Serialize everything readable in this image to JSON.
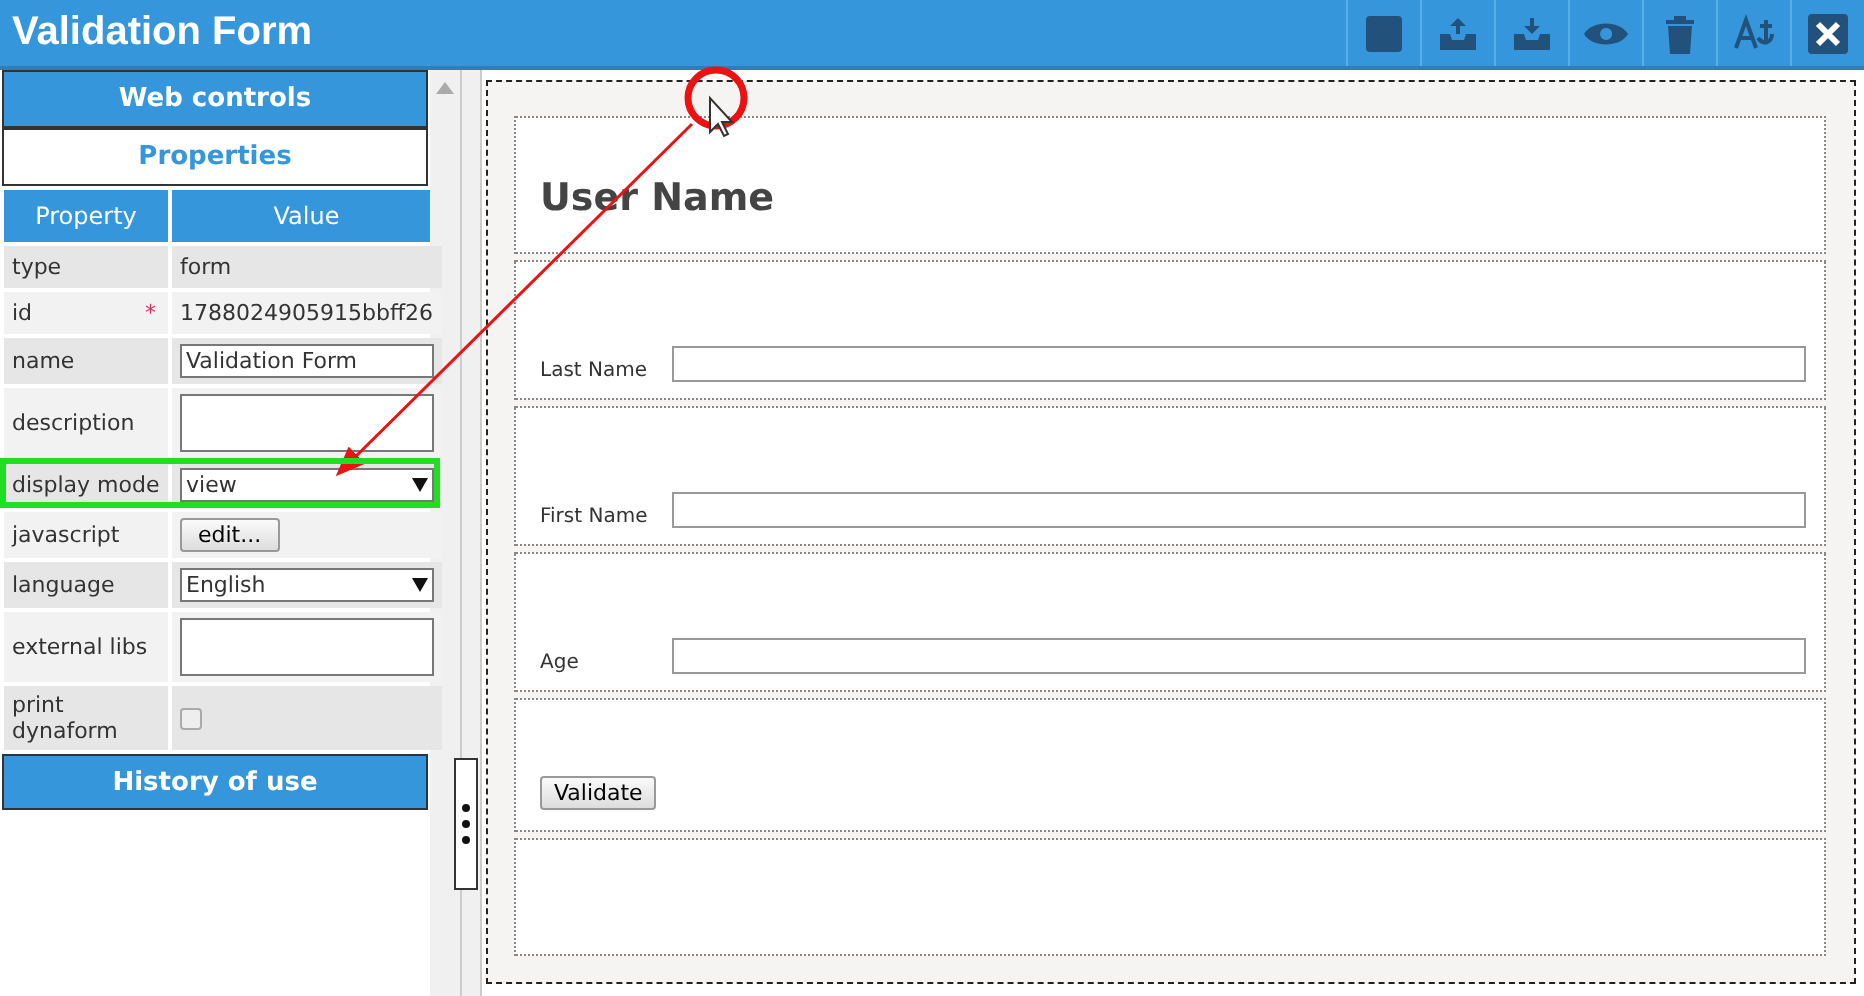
{
  "window": {
    "title": "Validation Form"
  },
  "sidebar": {
    "sections": [
      {
        "label": "Web controls",
        "expanded": false
      },
      {
        "label": "Properties",
        "expanded": true
      }
    ],
    "columns": [
      "Property",
      "Value"
    ],
    "rows": [
      {
        "kind": "text",
        "property": "type",
        "value": "form"
      },
      {
        "kind": "text",
        "property": "id",
        "required_mark": "*",
        "value": "1788024905915bbff26"
      },
      {
        "kind": "input",
        "property": "name",
        "value": "Validation Form"
      },
      {
        "kind": "textarea",
        "property": "description"
      },
      {
        "kind": "select",
        "property": "display mode",
        "value": "view",
        "highlighted": true
      },
      {
        "kind": "button",
        "property": "javascript",
        "value": "edit..."
      },
      {
        "kind": "select",
        "property": "language",
        "value": "English",
        "highlighted": false
      },
      {
        "kind": "textarea",
        "property": "external libs"
      },
      {
        "kind": "checkbox",
        "property": "print dynaform",
        "checked": false
      }
    ],
    "footer": "History of use"
  },
  "form": {
    "rows": [
      {
        "kind": "heading",
        "label": "User Name"
      },
      {
        "kind": "input",
        "label": "Last Name"
      },
      {
        "kind": "input",
        "label": "First Name"
      },
      {
        "kind": "input",
        "label": "Age"
      },
      {
        "kind": "button",
        "label": "Validate"
      },
      {
        "kind": "empty"
      }
    ]
  }
}
